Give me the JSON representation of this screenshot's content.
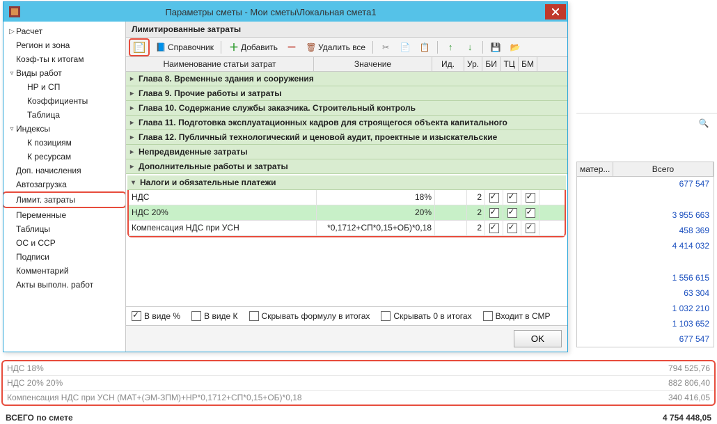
{
  "window": {
    "title": "Параметры сметы - Мои сметы\\Локальная смета1"
  },
  "sidebar": {
    "items": [
      {
        "label": "Расчет",
        "level": 0,
        "exp": "▷"
      },
      {
        "label": "Регион и зона",
        "level": 0,
        "exp": ""
      },
      {
        "label": "Коэф-ты к итогам",
        "level": 0,
        "exp": ""
      },
      {
        "label": "Виды работ",
        "level": 0,
        "exp": "▿"
      },
      {
        "label": "НР и СП",
        "level": 1,
        "exp": ""
      },
      {
        "label": "Коэффициенты",
        "level": 1,
        "exp": ""
      },
      {
        "label": "Таблица",
        "level": 1,
        "exp": ""
      },
      {
        "label": "Индексы",
        "level": 0,
        "exp": "▿"
      },
      {
        "label": "К позициям",
        "level": 1,
        "exp": ""
      },
      {
        "label": "К ресурсам",
        "level": 1,
        "exp": ""
      },
      {
        "label": "Доп. начисления",
        "level": 0,
        "exp": ""
      },
      {
        "label": "Автозагрузка",
        "level": 0,
        "exp": ""
      },
      {
        "label": "Лимит. затраты",
        "level": 0,
        "exp": "",
        "highlight": true
      },
      {
        "label": "Переменные",
        "level": 0,
        "exp": ""
      },
      {
        "label": "Таблицы",
        "level": 0,
        "exp": ""
      },
      {
        "label": "ОС и ССР",
        "level": 0,
        "exp": ""
      },
      {
        "label": "Подписи",
        "level": 0,
        "exp": ""
      },
      {
        "label": "Комментарий",
        "level": 0,
        "exp": ""
      },
      {
        "label": "Акты выполн. работ",
        "level": 0,
        "exp": ""
      }
    ]
  },
  "section": {
    "title": "Лимитированные затраты"
  },
  "toolbar": {
    "ref_label": "Справочник",
    "add_label": "Добавить",
    "delall_label": "Удалить все"
  },
  "grid": {
    "headers": {
      "c1": "Наименование статьи затрат",
      "c2": "Значение",
      "c3": "Ид.",
      "c4": "Ур.",
      "c5": "БИ",
      "c6": "ТЦ",
      "c7": "БМ"
    },
    "chapters": [
      "Глава 8. Временные здания и сооружения",
      "Глава 9. Прочие работы и затраты",
      "Глава 10. Содержание службы заказчика. Строительный контроль",
      "Глава 11. Подготовка эксплуатационных кадров для строящегося объекта капитального",
      "Глава 12. Публичный технологический и ценовой аудит, проектные и изыскательские",
      "Непредвиденные затраты",
      "Дополнительные работы и затраты",
      "Налоги и обязательные платежи"
    ],
    "rows": [
      {
        "name": "НДС",
        "value": "18%",
        "lvl": "2"
      },
      {
        "name": "НДС 20%",
        "value": "20%",
        "lvl": "2",
        "sel": true
      },
      {
        "name": "Компенсация НДС при УСН",
        "value": "*0,1712+СП*0,15+ОБ)*0,18",
        "lvl": "2"
      }
    ]
  },
  "footer": {
    "as_percent": "В виде %",
    "as_coef": "В виде К",
    "hide_formula": "Скрывать формулу в итогах",
    "hide_zero": "Скрывать 0 в итогах",
    "in_smr": "Входит в СМР",
    "ok": "OK"
  },
  "totals_panel": {
    "header_total": "Всего",
    "header_mat": "матер...",
    "rows": [
      "677 547",
      "",
      "3 955 663",
      "458 369",
      "4 414 032",
      "",
      "1 556 615",
      "63 304",
      "1 032 210",
      "1 103 652",
      "677 547"
    ]
  },
  "bottom": {
    "rows": [
      {
        "label": "НДС 18%",
        "value": "794 525,76"
      },
      {
        "label": "НДС 20% 20%",
        "value": "882 806,40"
      },
      {
        "label": "Компенсация НДС при УСН (МАТ+(ЭМ-ЗПМ)+НР*0,1712+СП*0,15+ОБ)*0,18",
        "value": "340 416,05"
      }
    ],
    "grand_label": "ВСЕГО по смете",
    "grand_value": "4 754 448,05"
  }
}
